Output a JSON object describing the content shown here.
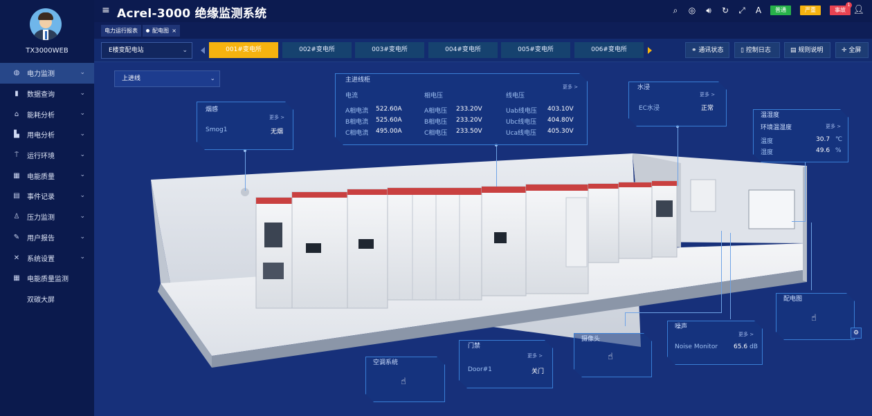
{
  "app": {
    "title": "Acrel-3000 绝缘监测系统"
  },
  "user": {
    "name": "TX3000WEB"
  },
  "sidebar": {
    "items": [
      {
        "label": "电力监测",
        "icon": "dashboard-icon"
      },
      {
        "label": "数据查询",
        "icon": "bar-chart-icon"
      },
      {
        "label": "能耗分析",
        "icon": "home-icon"
      },
      {
        "label": "用电分析",
        "icon": "chart-icon"
      },
      {
        "label": "运行环境",
        "icon": "pin-icon"
      },
      {
        "label": "电能质量",
        "icon": "grid-icon"
      },
      {
        "label": "事件记录",
        "icon": "document-icon"
      },
      {
        "label": "压力监测",
        "icon": "gauge-icon"
      },
      {
        "label": "用户报告",
        "icon": "edit-icon"
      },
      {
        "label": "系统设置",
        "icon": "tools-icon"
      },
      {
        "label": "电能质量监测",
        "icon": "grid-icon"
      },
      {
        "label": "双碳大屏",
        "icon": ""
      }
    ]
  },
  "header": {
    "badges": [
      {
        "label": "普通",
        "color": "#27b24a"
      },
      {
        "label": "严重",
        "color": "#f6b30f"
      },
      {
        "label": "事故",
        "color": "#e84352"
      }
    ],
    "notification_count": "1"
  },
  "tabs": [
    {
      "label": "电力运行报表"
    },
    {
      "label": "配电图"
    }
  ],
  "stations": {
    "selector": "E楼变配电站",
    "list": [
      "001#变电所",
      "002#变电所",
      "003#变电所",
      "004#变电所",
      "005#变电所",
      "006#变电所"
    ],
    "active_index": 0
  },
  "actions": [
    "通讯状态",
    "控制日志",
    "规则说明",
    "全屏"
  ],
  "line_selector": "上进线",
  "smoke": {
    "title": "烟感",
    "more": "更多 >",
    "label": "Smog1",
    "value": "无烟"
  },
  "main_line": {
    "title": "主进线柜",
    "more": "更多 >",
    "col_headers": [
      "电流",
      "相电压",
      "线电压"
    ],
    "rows": [
      [
        "A相电流",
        "522.60A",
        "A相电压",
        "233.20V",
        "Uab线电压",
        "403.10V"
      ],
      [
        "B相电流",
        "525.60A",
        "B相电压",
        "233.20V",
        "Ubc线电压",
        "404.80V"
      ],
      [
        "C相电流",
        "495.00A",
        "C相电压",
        "233.50V",
        "Uca线电压",
        "405.30V"
      ]
    ]
  },
  "water": {
    "title": "水浸",
    "more": "更多 >",
    "label": "EC水浸",
    "value": "正常"
  },
  "temp": {
    "title": "温湿度",
    "subtitle": "环境温湿度",
    "more": "更多 >",
    "t_label": "温度",
    "t_value": "30.7",
    "t_unit": "℃",
    "h_label": "湿度",
    "h_value": "49.6",
    "h_unit": "%"
  },
  "ac": {
    "title": "空调系统"
  },
  "door": {
    "title": "门禁",
    "more": "更多 >",
    "label": "Door#1",
    "value": "关门"
  },
  "camera": {
    "title": "摄像头"
  },
  "noise": {
    "title": "噪声",
    "more": "更多 >",
    "label": "Noise Monitor",
    "value": "65.6",
    "unit": "dB"
  },
  "diagram": {
    "title": "配电图"
  }
}
